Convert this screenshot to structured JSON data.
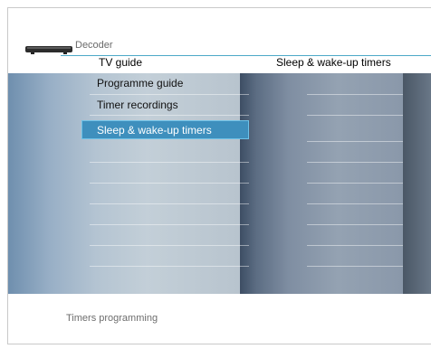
{
  "header": {
    "source_label": "Decoder",
    "col1_title": "TV guide",
    "col2_title": "Sleep & wake-up timers"
  },
  "menu": {
    "items": [
      {
        "label": "Programme guide"
      },
      {
        "label": "Timer recordings"
      },
      {
        "label": "Sleep & wake-up timers",
        "selected": true
      }
    ]
  },
  "status": {
    "text": "Timers programming"
  },
  "colors": {
    "accent": "#3e8fbd",
    "header_rule": "#4da9c8"
  },
  "icons": {
    "device": "set-top-box-icon"
  }
}
